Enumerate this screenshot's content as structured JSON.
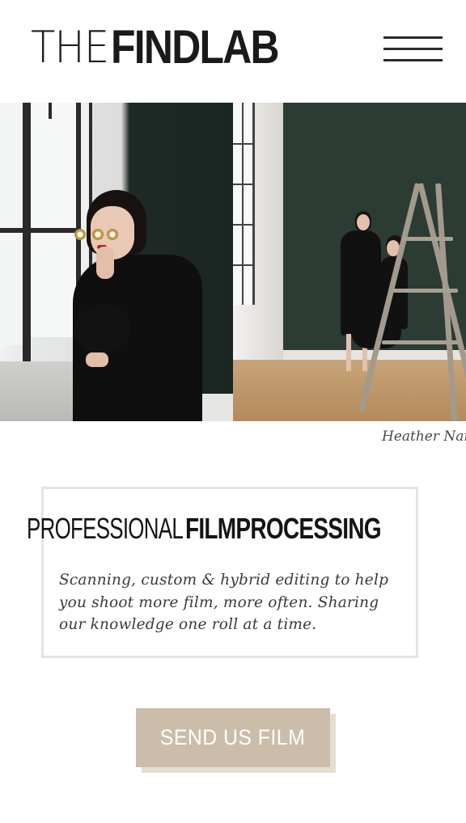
{
  "header": {
    "logo_light": "THE",
    "logo_bold": "FINDLAB",
    "menu_icon": "hamburger-menu-icon"
  },
  "hero": {
    "photo_credit": "Heather Nan"
  },
  "tagline": {
    "heading_light": "PROFESSIONAL",
    "heading_bold": "FILMPROCESSING",
    "body": "Scanning, custom & hybrid editing to help you shoot more film, more often. Sharing our knowledge one roll at a time."
  },
  "cta": {
    "label": "SEND US FILM"
  },
  "colors": {
    "cta_background": "#cbbdaa",
    "cta_shadow": "#e6ddd3",
    "box_border": "#e4e4e4",
    "text_dark": "#151515",
    "wall_green": "#2c3c35"
  }
}
